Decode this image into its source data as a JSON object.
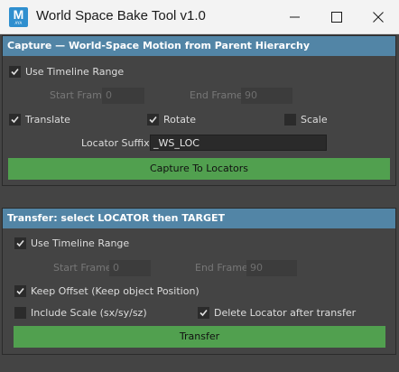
{
  "window": {
    "title": "World Space Bake Tool v1.0",
    "icon_letter": "M",
    "icon_caption": "AYA"
  },
  "capture": {
    "header": "Capture — World-Space Motion from Parent Hierarchy",
    "use_timeline_label": "Use Timeline Range",
    "use_timeline_checked": true,
    "start_frame_label": "Start Frame",
    "start_frame_value": "0",
    "end_frame_label": "End Frame",
    "end_frame_value": "90",
    "translate_label": "Translate",
    "translate_checked": true,
    "rotate_label": "Rotate",
    "rotate_checked": true,
    "scale_label": "Scale",
    "scale_checked": false,
    "locator_suffix_label": "Locator Suffix",
    "locator_suffix_value": "_WS_LOC",
    "button_label": "Capture To Locators"
  },
  "transfer": {
    "header": "Transfer: select LOCATOR then TARGET",
    "use_timeline_label": "Use Timeline Range",
    "use_timeline_checked": true,
    "start_frame_label": "Start Frame",
    "start_frame_value": "0",
    "end_frame_label": "End Frame",
    "end_frame_value": "90",
    "keep_offset_label": "Keep Offset (Keep object Position)",
    "keep_offset_checked": true,
    "include_scale_label": "Include Scale (sx/sy/sz)",
    "include_scale_checked": false,
    "delete_locator_label": "Delete Locator after transfer",
    "delete_locator_checked": true,
    "button_label": "Transfer"
  },
  "colors": {
    "header": "#5285a6",
    "button": "#51a04f",
    "panel": "#444444"
  }
}
